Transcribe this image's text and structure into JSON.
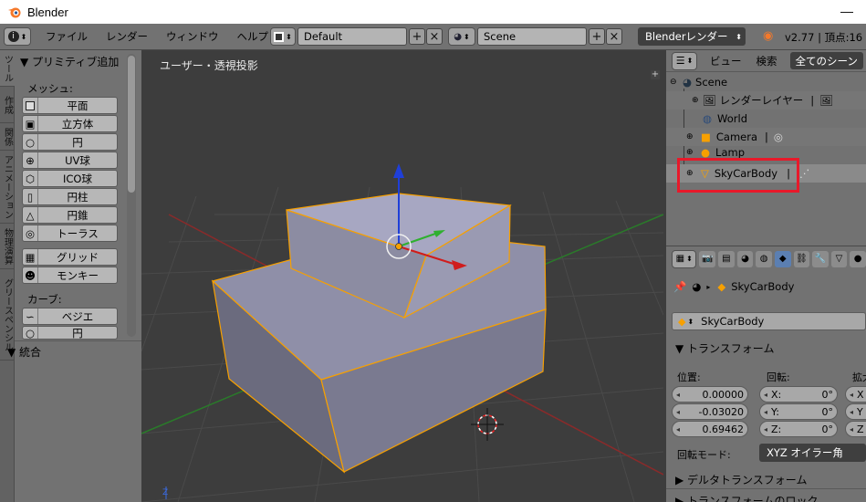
{
  "window": {
    "title": "Blender"
  },
  "infobar": {
    "menus": [
      "ファイル",
      "レンダー",
      "ウィンドウ",
      "ヘルプ"
    ],
    "screen_layout": "Default",
    "scene": "Scene",
    "render_engine": "Blenderレンダー",
    "version_info": "v2.77 | 頂点:16 |"
  },
  "toolshelf": {
    "tabs": [
      "ツール",
      "作成",
      "関係",
      "アニメーション",
      "物理演算",
      "グリースペンシル"
    ],
    "panel_title": "▼ プリミティブ追加",
    "mesh_label": "メッシュ:",
    "mesh_tools": [
      "平面",
      "立方体",
      "円",
      "UV球",
      "ICO球",
      "円柱",
      "円錐",
      "トーラス"
    ],
    "grid_tools": [
      "グリッド",
      "モンキー"
    ],
    "curve_label": "カーブ:",
    "curve_tools": [
      "ベジエ",
      "円"
    ],
    "bottom_panel": "▼ 統合"
  },
  "viewport": {
    "label": "ユーザー・透視投影"
  },
  "outliner": {
    "view_menu": "ビュー",
    "search_menu": "検索",
    "filter": "全てのシーン",
    "items": [
      "Scene",
      "レンダーレイヤー",
      "World",
      "Camera",
      "Lamp",
      "SkyCarBody"
    ]
  },
  "properties": {
    "object_breadcrumb": "SkyCarBody",
    "object_name": "SkyCarBody",
    "transform_header": "▼ トランスフォーム",
    "location_label": "位置:",
    "rotation_label": "回転:",
    "scale_label": "拡大",
    "location": [
      "0.00000",
      "-0.03020",
      "0.69462"
    ],
    "rotation_axes": [
      "X:",
      "Y:",
      "Z:"
    ],
    "rotation_values": [
      "0°",
      "0°",
      "0°"
    ],
    "scale_axes": [
      "X",
      "Y",
      "Z"
    ],
    "rotation_mode_label": "回転モード:",
    "rotation_mode": "XYZ オイラー角",
    "delta_header": "▶ デルタトランスフォーム",
    "lock_header": "▶ トランスフォームのロック"
  },
  "colors": {
    "accent_orange": "#f7a000",
    "highlight_red": "#e8192a",
    "panel_gray": "#727272"
  }
}
